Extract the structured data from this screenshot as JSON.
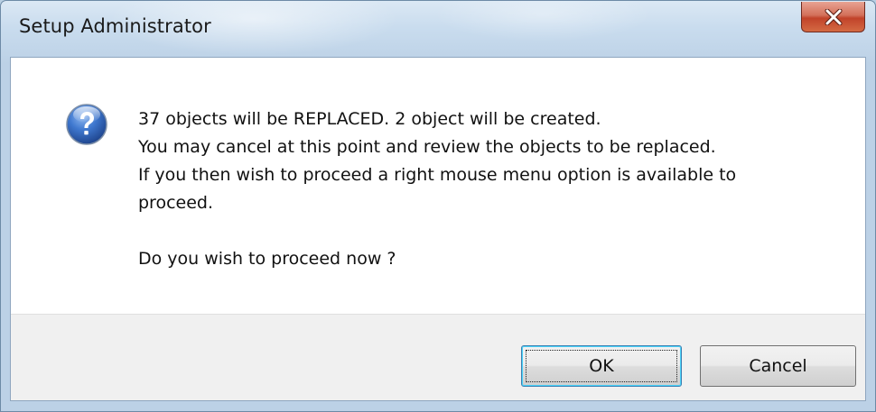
{
  "window": {
    "title": "Setup Administrator"
  },
  "titlebar": {
    "close_icon": "close-x-icon"
  },
  "dialog": {
    "icon": "question-icon",
    "message_lines": [
      "37 objects will be REPLACED. 2 object will be created.",
      "You may cancel at this point and review the objects to be replaced.",
      "If you then wish to proceed a right mouse menu option is available to",
      "proceed."
    ],
    "prompt": "Do you wish to proceed now ?"
  },
  "buttons": {
    "ok_label": "OK",
    "cancel_label": "Cancel"
  },
  "colors": {
    "close_button": "#c1432a",
    "icon_blue": "#2b5fb0",
    "default_button_border": "#3c7fb1"
  }
}
